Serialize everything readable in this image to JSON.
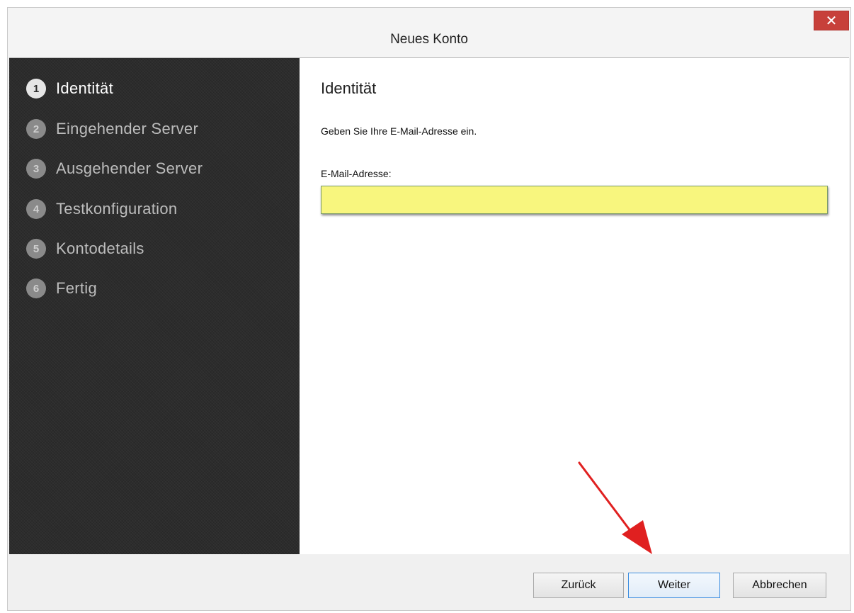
{
  "window": {
    "title": "Neues Konto",
    "close_symbol": "✕"
  },
  "sidebar": {
    "steps": [
      {
        "number": "1",
        "label": "Identität",
        "active": true
      },
      {
        "number": "2",
        "label": "Eingehender Server",
        "active": false
      },
      {
        "number": "3",
        "label": "Ausgehender Server",
        "active": false
      },
      {
        "number": "4",
        "label": "Testkonfiguration",
        "active": false
      },
      {
        "number": "5",
        "label": "Kontodetails",
        "active": false
      },
      {
        "number": "6",
        "label": "Fertig",
        "active": false
      }
    ]
  },
  "main": {
    "heading": "Identität",
    "instruction": "Geben Sie Ihre E-Mail-Adresse ein.",
    "email_label": "E-Mail-Adresse:",
    "email_value": ""
  },
  "footer": {
    "back_label": "Zurück",
    "next_label": "Weiter",
    "cancel_label": "Abbrechen"
  },
  "colors": {
    "sidebar_bg": "#2c2c2c",
    "input_highlight": "#f8f67e",
    "close_button": "#c7403a",
    "annotation_arrow": "#e02020"
  },
  "annotations": {
    "arrow": "red-arrow pointing to Weiter button"
  }
}
